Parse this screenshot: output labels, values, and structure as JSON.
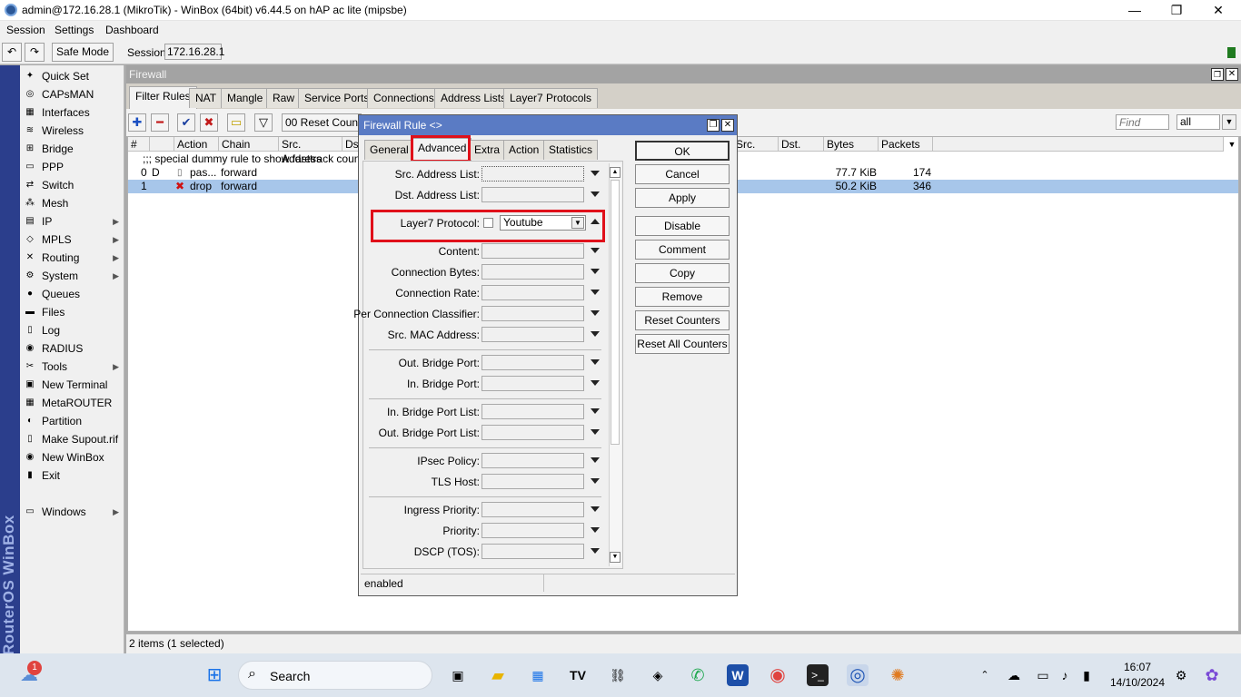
{
  "window": {
    "title": "admin@172.16.28.1 (MikroTik) - WinBox (64bit) v6.44.5 on hAP ac lite (mipsbe)",
    "minimize": "—",
    "maximize": "❐",
    "close": "✕"
  },
  "menu": {
    "session": "Session",
    "settings": "Settings",
    "dashboard": "Dashboard"
  },
  "toolbar": {
    "undo": "↶",
    "redo": "↷",
    "safe_mode": "Safe Mode",
    "session_label": "Session:",
    "session_value": "172.16.28.1"
  },
  "sidebar": {
    "brand": "RouterOS WinBox",
    "items": [
      {
        "label": "Quick Set",
        "icon": "✦"
      },
      {
        "label": "CAPsMAN",
        "icon": "◎"
      },
      {
        "label": "Interfaces",
        "icon": "▦"
      },
      {
        "label": "Wireless",
        "icon": "≋"
      },
      {
        "label": "Bridge",
        "icon": "⊞"
      },
      {
        "label": "PPP",
        "icon": "▭"
      },
      {
        "label": "Switch",
        "icon": "⇄"
      },
      {
        "label": "Mesh",
        "icon": "⁂"
      },
      {
        "label": "IP",
        "icon": "▤",
        "arrow": "▶"
      },
      {
        "label": "MPLS",
        "icon": "◇",
        "arrow": "▶"
      },
      {
        "label": "Routing",
        "icon": "✕",
        "arrow": "▶"
      },
      {
        "label": "System",
        "icon": "⚙",
        "arrow": "▶"
      },
      {
        "label": "Queues",
        "icon": "●"
      },
      {
        "label": "Files",
        "icon": "▬"
      },
      {
        "label": "Log",
        "icon": "▯"
      },
      {
        "label": "RADIUS",
        "icon": "◉"
      },
      {
        "label": "Tools",
        "icon": "✂",
        "arrow": "▶"
      },
      {
        "label": "New Terminal",
        "icon": "▣"
      },
      {
        "label": "MetaROUTER",
        "icon": "▦"
      },
      {
        "label": "Partition",
        "icon": "◐"
      },
      {
        "label": "Make Supout.rif",
        "icon": "▯"
      },
      {
        "label": "New WinBox",
        "icon": "◉"
      },
      {
        "label": "Exit",
        "icon": "▮"
      }
    ],
    "windows": {
      "label": "Windows",
      "icon": "▭",
      "arrow": "▶"
    }
  },
  "firewall": {
    "title": "Firewall",
    "tabs": [
      "Filter Rules",
      "NAT",
      "Mangle",
      "Raw",
      "Service Ports",
      "Connections",
      "Address Lists",
      "Layer7 Protocols"
    ],
    "toolbar": {
      "add": "✚",
      "remove": "━",
      "enable": "✔",
      "disable": "✖",
      "comment": "▭",
      "filter": "▽",
      "reset_counters": "00 Reset Counters",
      "find_placeholder": "Find",
      "scope": "all"
    },
    "columns": [
      "#",
      "",
      "Action",
      "Chain",
      "Src. Address",
      "Dst",
      "Src. Ad...",
      "Dst. Ad...",
      "Bytes",
      "Packets"
    ],
    "comment_row": ";;; special dummy rule to show fasttrack counters",
    "rows": [
      {
        "num": "0",
        "flag": "D",
        "action": "pas...",
        "chain": "forward",
        "bytes": "77.7 KiB",
        "packets": "174"
      },
      {
        "num": "1",
        "flag": "",
        "action": "drop",
        "chain": "forward",
        "bytes": "50.2 KiB",
        "packets": "346"
      }
    ],
    "status": "2 items (1 selected)"
  },
  "dialog": {
    "title": "Firewall Rule <>",
    "tabs": [
      "General",
      "Advanced",
      "Extra",
      "Action",
      "Statistics"
    ],
    "fields": [
      {
        "label": "Src. Address List:"
      },
      {
        "label": "Dst. Address List:"
      },
      {
        "label": "Layer7 Protocol:",
        "value": "Youtube"
      },
      {
        "label": "Content:"
      },
      {
        "label": "Connection Bytes:"
      },
      {
        "label": "Connection Rate:"
      },
      {
        "label": "Per Connection Classifier:"
      },
      {
        "label": "Src. MAC Address:"
      },
      {
        "label": "Out. Bridge Port:"
      },
      {
        "label": "In. Bridge Port:"
      },
      {
        "label": "In. Bridge Port List:"
      },
      {
        "label": "Out. Bridge Port List:"
      },
      {
        "label": "IPsec Policy:"
      },
      {
        "label": "TLS Host:"
      },
      {
        "label": "Ingress Priority:"
      },
      {
        "label": "Priority:"
      },
      {
        "label": "DSCP (TOS):"
      }
    ],
    "buttons": [
      "OK",
      "Cancel",
      "Apply",
      "Disable",
      "Comment",
      "Copy",
      "Remove",
      "Reset Counters",
      "Reset All Counters"
    ],
    "status": "enabled"
  },
  "taskbar": {
    "search": "Search",
    "notification_count": "1",
    "time": "16:07",
    "date": "14/10/2024"
  }
}
